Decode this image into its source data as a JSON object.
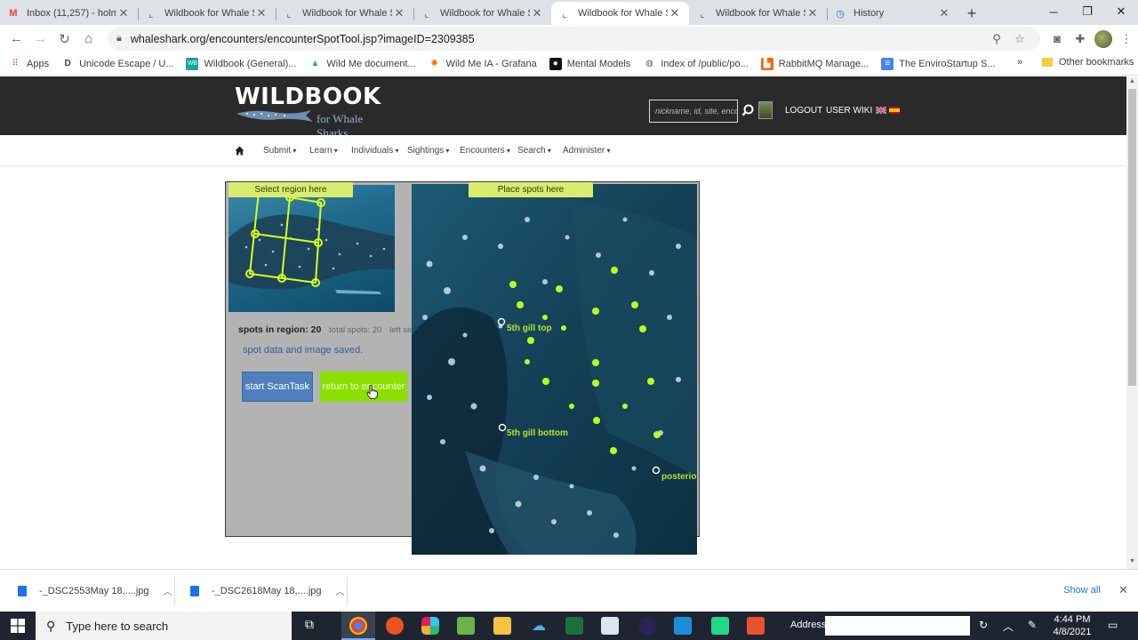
{
  "browser": {
    "tabs": [
      {
        "title": "Inbox (11,257) - holmb",
        "icon": "gmail-icon"
      },
      {
        "title": "Wildbook for Whale Sh",
        "icon": "wildbook-icon"
      },
      {
        "title": "Wildbook for Whale Sh",
        "icon": "wildbook-icon"
      },
      {
        "title": "Wildbook for Whale Sh",
        "icon": "wildbook-icon"
      },
      {
        "title": "Wildbook for Whale Sh",
        "icon": "wildbook-icon",
        "active": true
      },
      {
        "title": "Wildbook for Whale Sh",
        "icon": "wildbook-icon"
      },
      {
        "title": "History",
        "icon": "history-icon"
      }
    ],
    "url": "whaleshark.org/encounters/encounterSpotTool.jsp?imageID=2309385",
    "bookmarks": [
      {
        "label": "Apps",
        "icon": "apps-grid-icon",
        "color": "#ea4335"
      },
      {
        "label": "Unicode Escape / U...",
        "icon": "unicode-icon",
        "color": "#333333"
      },
      {
        "label": "Wildbook (General)...",
        "icon": "wildbook-bm-icon",
        "color": "#1aa39a"
      },
      {
        "label": "Wild Me document...",
        "icon": "drive-icon",
        "color": "#34a853"
      },
      {
        "label": "Wild Me IA - Grafana",
        "icon": "grafana-icon",
        "color": "#f46800"
      },
      {
        "label": "Mental Models",
        "icon": "mental-models-icon",
        "color": "#111111"
      },
      {
        "label": "Index of /public/po...",
        "icon": "globe-icon",
        "color": "#5f6368"
      },
      {
        "label": "RabbitMQ Manage...",
        "icon": "rabbitmq-icon",
        "color": "#ff6600"
      },
      {
        "label": "The EnviroStartup S...",
        "icon": "docs-icon",
        "color": "#4285f4"
      }
    ],
    "bookmarks_more": "»",
    "other_bookmarks": "Other bookmarks"
  },
  "site": {
    "logo_text": "WILDBOOK",
    "logo_sub": "for Whale Sharks",
    "search_placeholder": "nickname, id, site, encounter",
    "logout": "LOGOUT",
    "user_wiki": "USER WIKI",
    "nav": [
      "Submit",
      "Learn",
      "Individuals",
      "Sightings",
      "Encounters",
      "Search",
      "Administer"
    ]
  },
  "tool": {
    "select_region_label": "Select region here",
    "place_spots_label": "Place spots here",
    "spots_in_region": "spots in region: 20",
    "total_spots": "total spots: 20",
    "side": "left side",
    "saved_message": "spot data and image saved.",
    "start_scan_button": "start ScanTask",
    "return_button": "return to encounter",
    "reference_labels": [
      "5th gill top",
      "5th gill bottom",
      "posterior"
    ]
  },
  "downloads": {
    "items": [
      "-_DSC2553May 18,....jpg",
      "-_DSC2618May 18,....jpg"
    ],
    "show_all": "Show all"
  },
  "taskbar": {
    "search_placeholder": "Type here to search",
    "address_label": "Address",
    "time": "4:44 PM",
    "date": "4/8/2021"
  }
}
